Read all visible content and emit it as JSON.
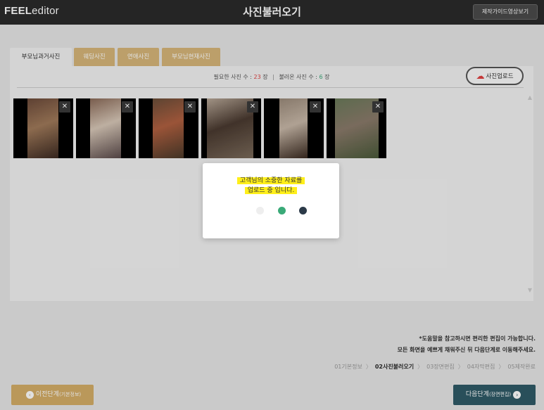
{
  "header": {
    "logo_bold": "FEEL",
    "logo_light": "editor",
    "title": "사진불러오기",
    "guide_button": "제작가이드영상보기"
  },
  "tabs": [
    {
      "label": "부모님과거사진",
      "active": true
    },
    {
      "label": "웨딩사진",
      "active": false
    },
    {
      "label": "연애사진",
      "active": false
    },
    {
      "label": "부모님현재사진",
      "active": false
    }
  ],
  "counts": {
    "required_label": "필요한 사진 수 :",
    "required_value": "23",
    "required_unit": "장",
    "separator": "|",
    "loaded_label": "불러온 사진 수 :",
    "loaded_value": "6",
    "loaded_unit": "장"
  },
  "upload_button": "사진업로드",
  "photos": [
    {
      "close": "✕",
      "colors": [
        "#6b4a3a",
        "#a07a5a",
        "#3c2a22"
      ]
    },
    {
      "close": "✕",
      "colors": [
        "#8a6a58",
        "#d8c8b8",
        "#5a4a4a"
      ]
    },
    {
      "close": "✕",
      "colors": [
        "#6a4e3a",
        "#b06040",
        "#4a3a2a"
      ]
    },
    {
      "close": "✕",
      "colors": [
        "#b8a898",
        "#4a3a30",
        "#7a6a5a"
      ]
    },
    {
      "close": "✕",
      "colors": [
        "#9a8a7a",
        "#c8b8a8",
        "#3a2a20"
      ]
    },
    {
      "close": "✕",
      "colors": [
        "#6a7a5a",
        "#8a7a6a",
        "#4a5a3a"
      ]
    }
  ],
  "modal": {
    "line1": "고객님의 소중한 자료를",
    "line2": "업로드 중 입니다.",
    "dot_colors": [
      "#eeeeee",
      "#3aaa78",
      "#2b3a48"
    ]
  },
  "hints": {
    "line1": "*도움말을 참고하시면 편리한 편집이 가능합니다.",
    "line2": "모든 화면을 예쁘게 채워주신 뒤 다음단계로 이동해주세요."
  },
  "steps": {
    "s1": "01기본정보",
    "s2": "02사진불러오기",
    "s3": "03장면편집",
    "s4": "04자막편집",
    "s5": "05제작완료",
    "arrow": "〉"
  },
  "prev_button": {
    "icon": "‹",
    "label": "이전단계",
    "sub": "(기본정보)"
  },
  "next_button": {
    "icon": "›",
    "label": "다음단계",
    "sub": "(장면편집)"
  },
  "colors": {
    "accent_gold": "#d4ad67",
    "accent_teal": "#2f5b67",
    "highlight": "#ffef1a"
  }
}
